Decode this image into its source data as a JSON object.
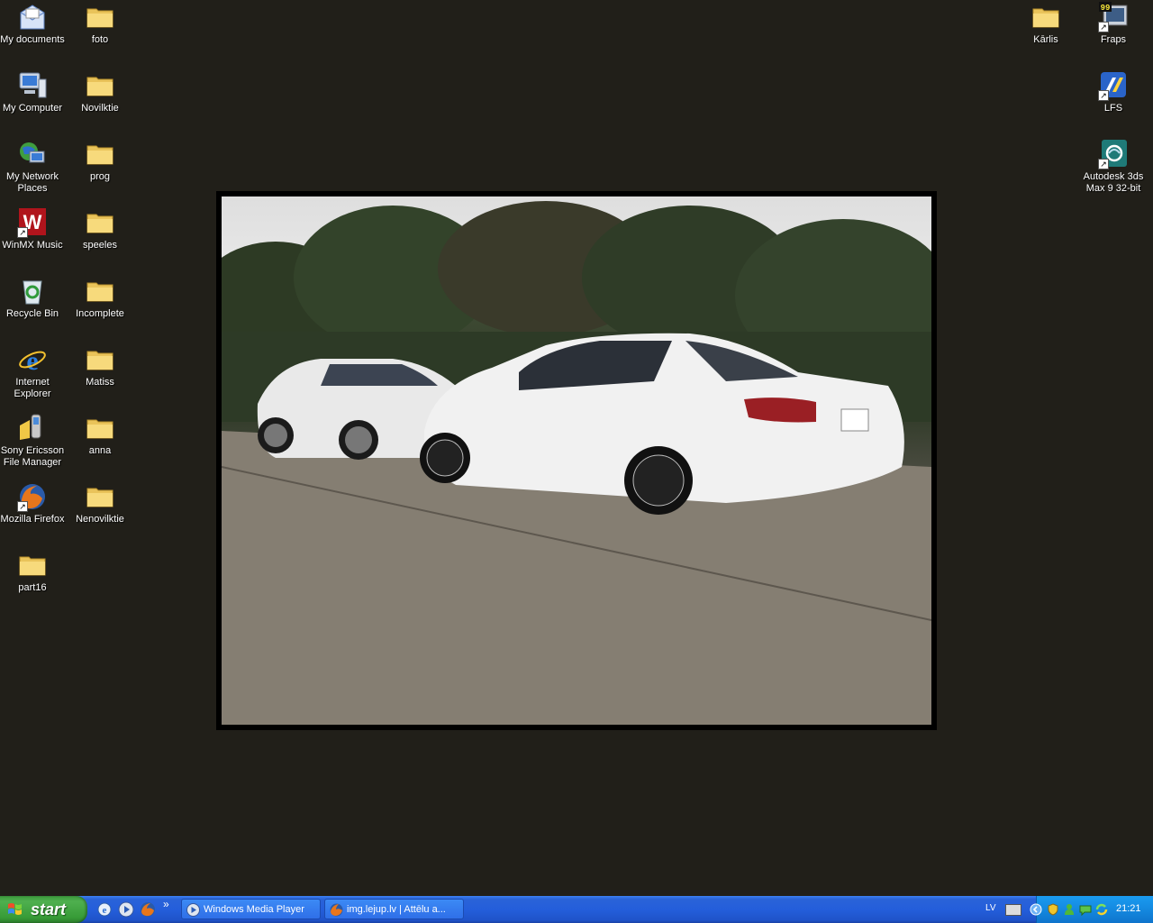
{
  "desktop": {
    "left_col1": [
      {
        "label": "My documents",
        "icon": "my-documents-icon"
      },
      {
        "label": "My Computer",
        "icon": "my-computer-icon"
      },
      {
        "label": "My Network Places",
        "icon": "network-places-icon"
      },
      {
        "label": "WinMX Music",
        "icon": "winmx-icon"
      },
      {
        "label": "Recycle Bin",
        "icon": "recycle-bin-icon"
      },
      {
        "label": "Internet Explorer",
        "icon": "internet-explorer-icon"
      },
      {
        "label": "Sony Ericsson File Manager",
        "icon": "phone-icon"
      },
      {
        "label": "Mozilla Firefox",
        "icon": "firefox-icon"
      },
      {
        "label": "part16",
        "icon": "folder-icon"
      }
    ],
    "left_col2": [
      {
        "label": "foto"
      },
      {
        "label": "Novilktie"
      },
      {
        "label": "prog"
      },
      {
        "label": "speeles"
      },
      {
        "label": "Incomplete"
      },
      {
        "label": "Matiss"
      },
      {
        "label": "anna"
      },
      {
        "label": "Nenovilktie"
      }
    ],
    "right": [
      {
        "label": "Kārlis",
        "icon": "folder-icon"
      },
      {
        "label": "Fraps",
        "icon": "fraps-icon",
        "badge": "99"
      },
      {
        "label": "LFS",
        "icon": "lfs-icon"
      },
      {
        "label": "Autodesk 3ds Max 9 32-bit",
        "icon": "3dsmax-icon"
      }
    ]
  },
  "taskbar": {
    "start_label": "start",
    "tasks": [
      {
        "label": "Windows Media Player",
        "icon": "media-player-icon"
      },
      {
        "label": "img.lejup.lv | Attēlu a...",
        "icon": "firefox-icon"
      }
    ],
    "chevron": "»",
    "language": "LV",
    "clock": "21:21"
  },
  "colors": {
    "desktop_bg": "#211f19",
    "taskbar_blue": "#245edb",
    "start_green": "#3d9a3d",
    "tray_blue": "#1489e0"
  }
}
